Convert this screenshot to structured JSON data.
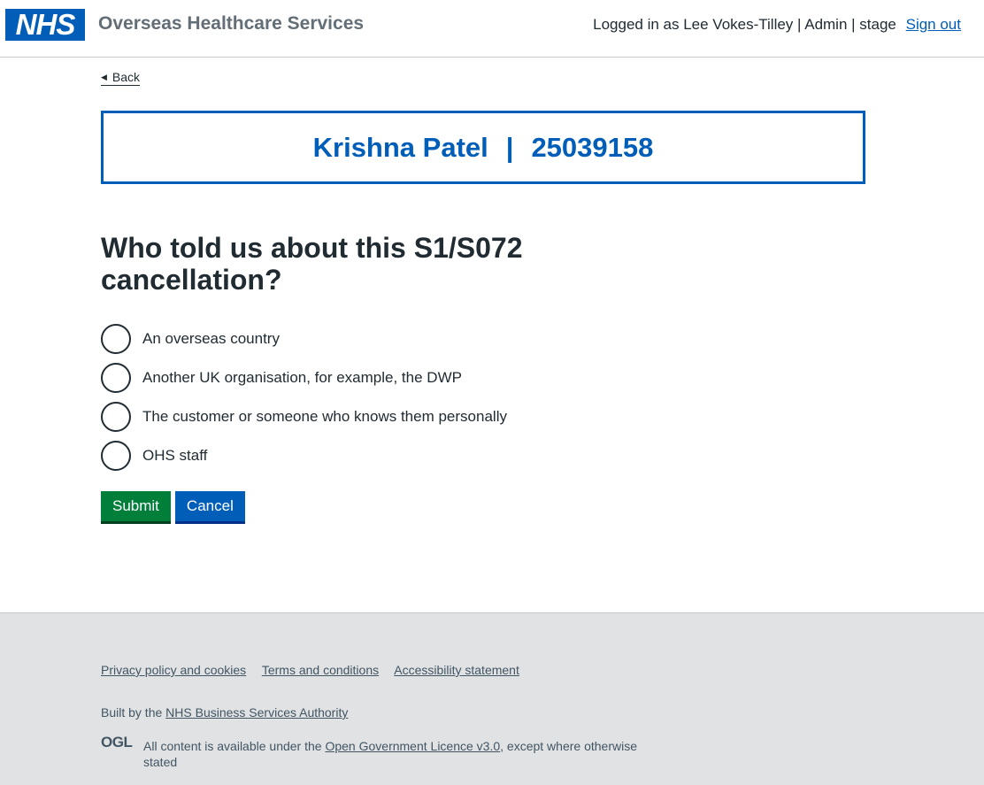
{
  "header": {
    "logo_text": "NHS",
    "service_name": "Overseas Healthcare Services",
    "account_text": "Logged in as Lee Vokes-Tilley | Admin | stage",
    "sign_out": "Sign out"
  },
  "back_link": "Back",
  "banner": {
    "patient_name": "Krishna Patel",
    "separator": "|",
    "patient_id": "25039158"
  },
  "question": "Who told us about this S1/S072 cancellation?",
  "options": [
    {
      "label": "An overseas country"
    },
    {
      "label": "Another UK organisation, for example, the DWP"
    },
    {
      "label": "The customer or someone who knows them personally"
    },
    {
      "label": "OHS staff"
    }
  ],
  "buttons": {
    "submit": "Submit",
    "cancel": "Cancel"
  },
  "footer": {
    "links": [
      "Privacy policy and cookies",
      "Terms and conditions",
      "Accessibility statement"
    ],
    "built_by_prefix": "Built by the",
    "built_by_link": "NHS Business Services Authority",
    "ogl_logo": "OGL",
    "licence_prefix": "All content is available under the",
    "licence_link": "Open Government Licence v3.0",
    "licence_suffix": ", except where otherwise stated"
  },
  "colors": {
    "nhs_blue": "#005eb8",
    "submit_green": "#007f3b",
    "footer_grey": "#e0e2e4"
  }
}
